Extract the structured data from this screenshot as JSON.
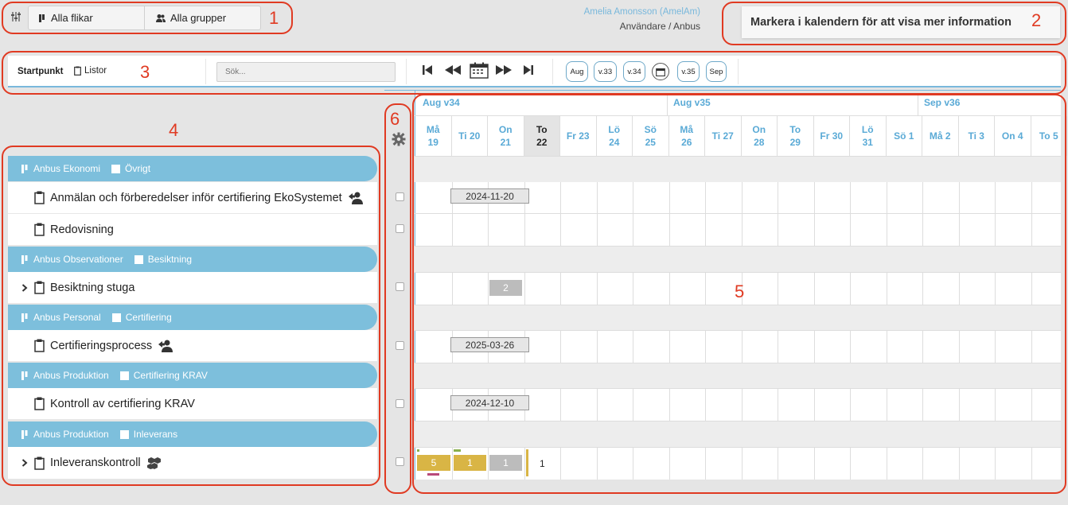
{
  "top_bar": {
    "all_tabs_label": "Alla flikar",
    "all_groups_label": "Alla grupper",
    "user_name": "Amelia Amonsson (AmelAm)",
    "user_role": "Användare / Anbus",
    "info_text": "Markera i kalendern för att visa mer information"
  },
  "toolbar": {
    "start_label": "Startpunkt",
    "lists_label": "Listor",
    "search_placeholder": "Sök...",
    "quick_buttons": [
      "Aug",
      "v.33",
      "v.34",
      "v.35",
      "Sep"
    ]
  },
  "annotations": [
    "1",
    "2",
    "3",
    "4",
    "5",
    "6"
  ],
  "calendar": {
    "weeks": [
      {
        "label": "Aug v34"
      },
      {
        "label": "Aug v35"
      },
      {
        "label": "Sep v36"
      }
    ],
    "days": [
      {
        "label": "Må\n19"
      },
      {
        "label": "Ti 20"
      },
      {
        "label": "On\n21"
      },
      {
        "label": "To\n22",
        "today": true
      },
      {
        "label": "Fr 23"
      },
      {
        "label": "Lö\n24"
      },
      {
        "label": "Sö\n25"
      },
      {
        "label": "Må\n26"
      },
      {
        "label": "Ti 27"
      },
      {
        "label": "On\n28"
      },
      {
        "label": "To\n29"
      },
      {
        "label": "Fr 30"
      },
      {
        "label": "Lö\n31"
      },
      {
        "label": "Sö 1"
      },
      {
        "label": "Må 2"
      },
      {
        "label": "Ti 3"
      },
      {
        "label": "On 4"
      },
      {
        "label": "To 5"
      }
    ]
  },
  "rows": [
    {
      "type": "group",
      "tab": "Anbus Ekonomi",
      "group": "Övrigt"
    },
    {
      "type": "item",
      "name": "Anmälan och förberedelser inför certifiering EkoSystemet",
      "date": "2024-11-20",
      "icon": "user-assign-icon"
    },
    {
      "type": "item",
      "name": "Redovisning"
    },
    {
      "type": "group",
      "tab": "Anbus Observationer",
      "group": "Besiktning"
    },
    {
      "type": "item",
      "name": "Besiktning stuga",
      "expandable": true,
      "count": "2"
    },
    {
      "type": "group",
      "tab": "Anbus Personal",
      "group": "Certifiering"
    },
    {
      "type": "item",
      "name": "Certifieringsprocess",
      "date": "2025-03-26",
      "icon": "user-assign-icon"
    },
    {
      "type": "group",
      "tab": "Anbus Produktion",
      "group": "Certifiering KRAV"
    },
    {
      "type": "item",
      "name": "Kontroll av certifiering KRAV",
      "date": "2024-12-10"
    },
    {
      "type": "group",
      "tab": "Anbus Produktion",
      "group": "Inleverans"
    },
    {
      "type": "item",
      "name": "Inleveranskontroll",
      "expandable": true,
      "icon": "boxes-icon",
      "counts": [
        "5",
        "1",
        "1",
        "1"
      ]
    }
  ],
  "colors": {
    "accent": "#7dbfdc",
    "annotation": "#e03a22",
    "count_yellow": "#d9b545",
    "count_grey": "#bcbcbc"
  }
}
